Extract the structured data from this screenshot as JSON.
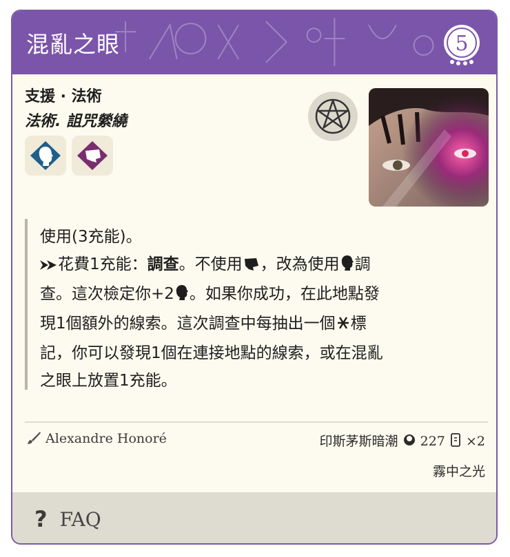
{
  "card": {
    "title": "混亂之眼",
    "cost": "5",
    "type_line": "支援 · 法術",
    "traits": "法術. 詛咒縈繞"
  },
  "text": {
    "line1": "使用(3充能)。",
    "l2_a": "花費1充能：",
    "l2_bold": "調查",
    "l2_b": "。不使用",
    "l2_c": "，改為使用",
    "l2_d": "調",
    "l3_a": "查。這次檢定你+2",
    "l3_b": "。如果你成功，在此地點發",
    "line4a": "現1個額外的線索。這次調查中每抽出一個",
    "line4b": "標",
    "line5": "記，你可以發現1個在連接地點的線索，或在混亂",
    "line6": "之眼上放置1充能。"
  },
  "footer_info": {
    "illustrator": "Alexandre Honoré",
    "set_name": "印斯茅斯暗潮",
    "card_number": "227",
    "quantity": "×2",
    "pack": "霧中之光"
  },
  "faq": {
    "label": "FAQ"
  },
  "colors": {
    "header": "#7b55aa",
    "card_bg": "#fdfbef",
    "footer_bg": "#dedbd0"
  },
  "icons": [
    "pentagram-icon",
    "willpower-icon",
    "intellect-icon",
    "combat-icon",
    "elder-sign-icon",
    "brush-icon",
    "set-icon",
    "card-quantity-icon",
    "question-icon"
  ]
}
